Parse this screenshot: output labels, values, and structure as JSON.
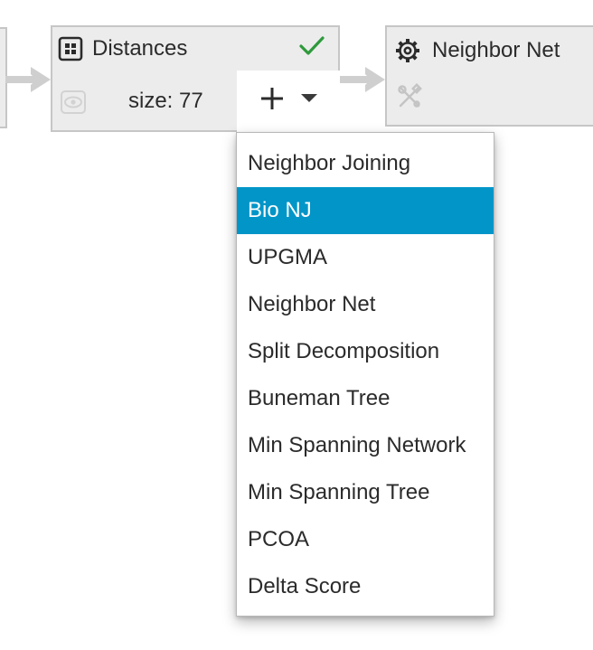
{
  "nodes": {
    "distances": {
      "title": "Distances",
      "size_label": "size: 77"
    },
    "neighbor_net": {
      "title": "Neighbor Net"
    }
  },
  "colors": {
    "check": "#2e9a3c",
    "selection": "#0195c8",
    "node_bg": "#ececec",
    "node_border": "#c6c6c6"
  },
  "icons": {
    "distances": "grid-icon",
    "status": "checkmark-icon",
    "visibility": "eye-icon",
    "add": "plus-icon",
    "menu": "chevron-down-icon",
    "algorithm": "gear-icon",
    "disabled_tools": "tools-crossed-icon"
  },
  "menu": {
    "items": [
      {
        "label": "Neighbor Joining",
        "selected": false
      },
      {
        "label": "Bio NJ",
        "selected": true
      },
      {
        "label": "UPGMA",
        "selected": false
      },
      {
        "label": "Neighbor Net",
        "selected": false
      },
      {
        "label": "Split Decomposition",
        "selected": false
      },
      {
        "label": "Buneman Tree",
        "selected": false
      },
      {
        "label": "Min Spanning Network",
        "selected": false
      },
      {
        "label": "Min Spanning Tree",
        "selected": false
      },
      {
        "label": "PCOA",
        "selected": false
      },
      {
        "label": "Delta Score",
        "selected": false
      }
    ]
  }
}
